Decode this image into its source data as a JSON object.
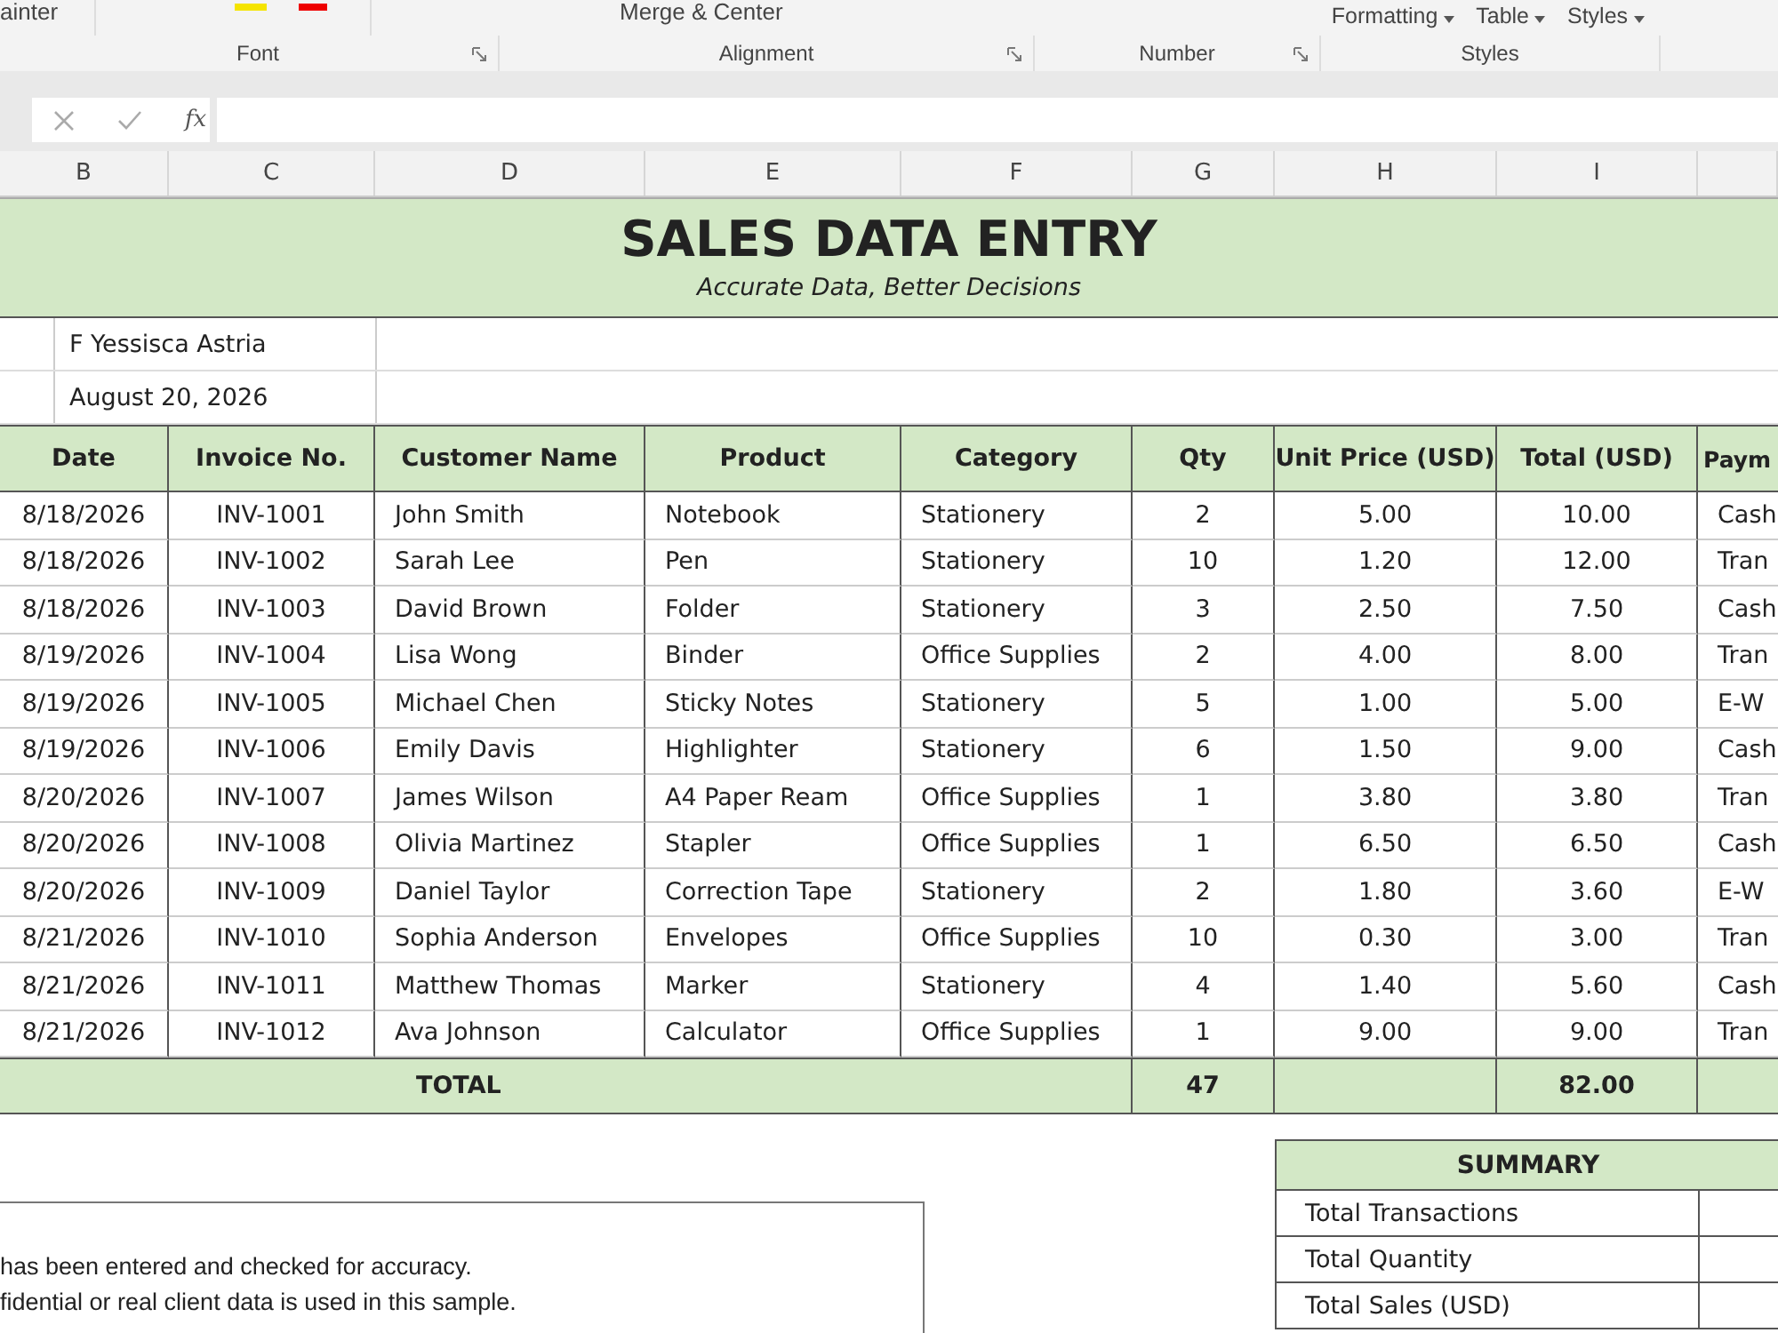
{
  "ribbon": {
    "top_texts": [
      "ainter",
      "Merge & Center"
    ],
    "groups": [
      {
        "label": "Font"
      },
      {
        "label": "Alignment"
      },
      {
        "label": "Number"
      },
      {
        "label": "Styles"
      }
    ],
    "style_buttons": [
      "Formatting",
      "Table",
      "Styles"
    ]
  },
  "formula_bar": {
    "fx": "fx"
  },
  "column_headers": [
    "B",
    "C",
    "D",
    "E",
    "F",
    "G",
    "H",
    "I"
  ],
  "title": "SALES DATA ENTRY",
  "subtitle": "Accurate Data, Better Decisions",
  "info": [
    "F Yessisca Astria",
    "August 20, 2026"
  ],
  "table": {
    "columns": [
      "Date",
      "Invoice No.",
      "Customer Name",
      "Product",
      "Category",
      "Qty",
      "Unit Price (USD)",
      "Total (USD)",
      "Paym"
    ],
    "rows": [
      [
        "8/18/2026",
        "INV-1001",
        "John Smith",
        "Notebook",
        "Stationery",
        "2",
        "5.00",
        "10.00",
        "Cash"
      ],
      [
        "8/18/2026",
        "INV-1002",
        "Sarah Lee",
        "Pen",
        "Stationery",
        "10",
        "1.20",
        "12.00",
        "Tran"
      ],
      [
        "8/18/2026",
        "INV-1003",
        "David Brown",
        "Folder",
        "Stationery",
        "3",
        "2.50",
        "7.50",
        "Cash"
      ],
      [
        "8/19/2026",
        "INV-1004",
        "Lisa Wong",
        "Binder",
        "Office Supplies",
        "2",
        "4.00",
        "8.00",
        "Tran"
      ],
      [
        "8/19/2026",
        "INV-1005",
        "Michael Chen",
        "Sticky Notes",
        "Stationery",
        "5",
        "1.00",
        "5.00",
        "E-W"
      ],
      [
        "8/19/2026",
        "INV-1006",
        "Emily Davis",
        "Highlighter",
        "Stationery",
        "6",
        "1.50",
        "9.00",
        "Cash"
      ],
      [
        "8/20/2026",
        "INV-1007",
        "James Wilson",
        "A4 Paper Ream",
        "Office Supplies",
        "1",
        "3.80",
        "3.80",
        "Tran"
      ],
      [
        "8/20/2026",
        "INV-1008",
        "Olivia Martinez",
        "Stapler",
        "Office Supplies",
        "1",
        "6.50",
        "6.50",
        "Cash"
      ],
      [
        "8/20/2026",
        "INV-1009",
        "Daniel Taylor",
        "Correction Tape",
        "Stationery",
        "2",
        "1.80",
        "3.60",
        "E-W"
      ],
      [
        "8/21/2026",
        "INV-1010",
        "Sophia Anderson",
        "Envelopes",
        "Office Supplies",
        "10",
        "0.30",
        "3.00",
        "Tran"
      ],
      [
        "8/21/2026",
        "INV-1011",
        "Matthew Thomas",
        "Marker",
        "Stationery",
        "4",
        "1.40",
        "5.60",
        "Cash"
      ],
      [
        "8/21/2026",
        "INV-1012",
        "Ava Johnson",
        "Calculator",
        "Office Supplies",
        "1",
        "9.00",
        "9.00",
        "Tran"
      ]
    ],
    "total": {
      "label": "TOTAL",
      "qty": "47",
      "amount": "82.00"
    }
  },
  "notes": [
    "has been entered and checked for accuracy.",
    "fidential or real client data is used in this sample."
  ],
  "summary": {
    "title": "SUMMARY",
    "rows": [
      "Total Transactions",
      "Total Quantity",
      "Total Sales (USD)"
    ]
  }
}
